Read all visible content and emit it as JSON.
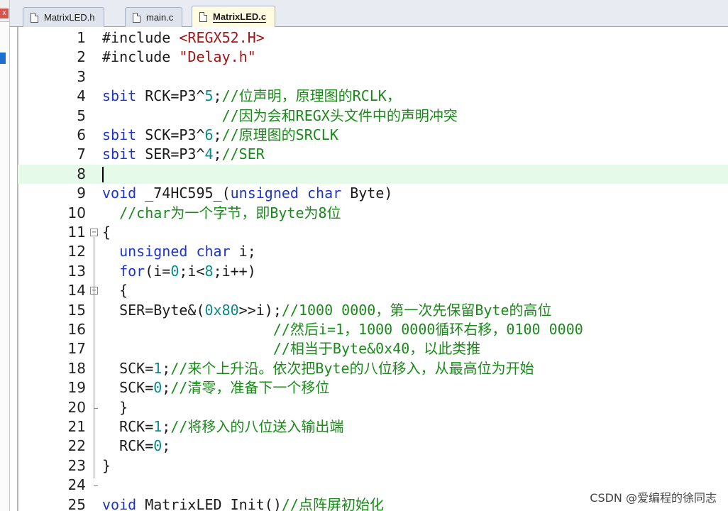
{
  "tabs": [
    {
      "label": "MatrixLED.h",
      "active": false
    },
    {
      "label": "main.c",
      "active": false
    },
    {
      "label": "MatrixLED.c",
      "active": true
    }
  ],
  "left_panel": {
    "close_glyph": "x"
  },
  "editor": {
    "current_line": 8,
    "lines": [
      {
        "n": "1",
        "parts": [
          [
            "pre",
            "#include "
          ],
          [
            "str",
            "<REGX52.H>"
          ]
        ]
      },
      {
        "n": "2",
        "parts": [
          [
            "pre",
            "#include "
          ],
          [
            "str",
            "\"Delay.h\""
          ]
        ]
      },
      {
        "n": "3",
        "parts": []
      },
      {
        "n": "4",
        "parts": [
          [
            "kw",
            "sbit"
          ],
          [
            "pre",
            " RCK=P3^"
          ],
          [
            "num",
            "5"
          ],
          [
            "pre",
            ";"
          ],
          [
            "com",
            "//位声明，原理图的RCLK，"
          ]
        ]
      },
      {
        "n": "5",
        "parts": [
          [
            "pre",
            "              "
          ],
          [
            "com",
            "//因为会和REGX头文件中的声明冲突"
          ]
        ]
      },
      {
        "n": "6",
        "parts": [
          [
            "kw",
            "sbit"
          ],
          [
            "pre",
            " SCK=P3^"
          ],
          [
            "num",
            "6"
          ],
          [
            "pre",
            ";"
          ],
          [
            "com",
            "//原理图的SRCLK"
          ]
        ]
      },
      {
        "n": "7",
        "parts": [
          [
            "kw",
            "sbit"
          ],
          [
            "pre",
            " SER=P3^"
          ],
          [
            "num",
            "4"
          ],
          [
            "pre",
            ";"
          ],
          [
            "com",
            "//SER"
          ]
        ]
      },
      {
        "n": "8",
        "parts": []
      },
      {
        "n": "9",
        "parts": [
          [
            "kw",
            "void"
          ],
          [
            "pre",
            " _74HC595_("
          ],
          [
            "kw",
            "unsigned char"
          ],
          [
            "pre",
            " Byte)"
          ]
        ]
      },
      {
        "n": "10",
        "parts": [
          [
            "pre",
            "  "
          ],
          [
            "com",
            "//char为一个字节，即Byte为8位"
          ]
        ]
      },
      {
        "n": "11",
        "parts": [
          [
            "pre",
            "{"
          ]
        ]
      },
      {
        "n": "12",
        "parts": [
          [
            "pre",
            "  "
          ],
          [
            "kw",
            "unsigned char"
          ],
          [
            "pre",
            " i;"
          ]
        ]
      },
      {
        "n": "13",
        "parts": [
          [
            "pre",
            "  "
          ],
          [
            "kw",
            "for"
          ],
          [
            "pre",
            "(i="
          ],
          [
            "num",
            "0"
          ],
          [
            "pre",
            ";i<"
          ],
          [
            "num",
            "8"
          ],
          [
            "pre",
            ";i++)"
          ]
        ]
      },
      {
        "n": "14",
        "parts": [
          [
            "pre",
            "  {"
          ]
        ]
      },
      {
        "n": "15",
        "parts": [
          [
            "pre",
            "  SER=Byte&("
          ],
          [
            "num",
            "0x80"
          ],
          [
            "pre",
            ">>i);"
          ],
          [
            "com",
            "//1000 0000，第一次先保留Byte的高位"
          ]
        ]
      },
      {
        "n": "16",
        "parts": [
          [
            "pre",
            "                    "
          ],
          [
            "com",
            "//然后i=1，1000 0000循环右移，0100 0000"
          ]
        ]
      },
      {
        "n": "17",
        "parts": [
          [
            "pre",
            "                    "
          ],
          [
            "com",
            "//相当于Byte&0x40，以此类推"
          ]
        ]
      },
      {
        "n": "18",
        "parts": [
          [
            "pre",
            "  SCK="
          ],
          [
            "num",
            "1"
          ],
          [
            "pre",
            ";"
          ],
          [
            "com",
            "//来个上升沿。依次把Byte的八位移入，从最高位为开始"
          ]
        ]
      },
      {
        "n": "19",
        "parts": [
          [
            "pre",
            "  SCK="
          ],
          [
            "num",
            "0"
          ],
          [
            "pre",
            ";"
          ],
          [
            "com",
            "//清零，准备下一个移位"
          ]
        ]
      },
      {
        "n": "20",
        "parts": [
          [
            "pre",
            "  }"
          ]
        ]
      },
      {
        "n": "21",
        "parts": [
          [
            "pre",
            "  RCK="
          ],
          [
            "num",
            "1"
          ],
          [
            "pre",
            ";"
          ],
          [
            "com",
            "//将移入的八位送入输出端"
          ]
        ]
      },
      {
        "n": "22",
        "parts": [
          [
            "pre",
            "  RCK="
          ],
          [
            "num",
            "0"
          ],
          [
            "pre",
            ";"
          ]
        ]
      },
      {
        "n": "23",
        "parts": [
          [
            "pre",
            "}"
          ]
        ]
      },
      {
        "n": "24",
        "parts": []
      },
      {
        "n": "25",
        "parts": [
          [
            "kw",
            "void"
          ],
          [
            "pre",
            " MatrixLED_Init()"
          ],
          [
            "com",
            "//点阵屏初始化"
          ]
        ]
      }
    ]
  },
  "watermark": "CSDN @爱编程的徐同志",
  "colors": {
    "keyword": "#1e35c8",
    "string": "#a31515",
    "number": "#0a8a8a",
    "comment": "#1a8a1a",
    "current_line_bg": "#e6faea"
  }
}
